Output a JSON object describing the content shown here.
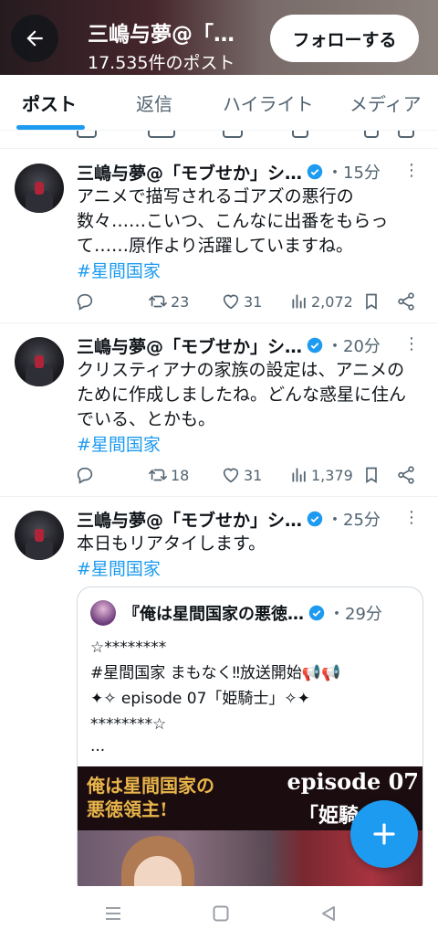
{
  "header": {
    "title": "三嶋与夢@「…",
    "post_count": "17.535件のポスト",
    "follow_label": "フォローする"
  },
  "tabs": [
    {
      "label": "ポスト",
      "active": true
    },
    {
      "label": "返信",
      "active": false
    },
    {
      "label": "ハイライト",
      "active": false
    },
    {
      "label": "メディア",
      "active": false
    }
  ],
  "tweets": [
    {
      "name": "三嶋与夢@「モブせか」シ…",
      "time": "・15分",
      "text_lines": [
        "アニメで描写されるゴアズの悪行の",
        "数々……こいつ、こんなに出番をもらっ",
        "て……原作より活躍していますね。"
      ],
      "hashtag": "#星間国家",
      "reposts": "23",
      "likes": "31",
      "views": "2,072"
    },
    {
      "name": "三嶋与夢@「モブせか」シ…",
      "time": "・20分",
      "text_lines": [
        "クリスティアナの家族の設定は、アニメの",
        "ために作成しましたね。どんな惑星に住ん",
        "でいる、とかも。"
      ],
      "hashtag": "#星間国家",
      "reposts": "18",
      "likes": "31",
      "views": "1,379"
    },
    {
      "name": "三嶋与夢@「モブせか」シ…",
      "time": "・25分",
      "text_lines": [
        "本日もリアタイします。"
      ],
      "hashtag": "#星間国家"
    }
  ],
  "quote": {
    "name": "『俺は星間国家の悪徳…",
    "time": "・29分",
    "lines": [
      "☆********",
      "  #星間国家 まもなく‼放送開始📢📢",
      "✦✧ episode 07「姫騎士」✧✦",
      "********☆",
      "..."
    ],
    "image": {
      "logo_line1": "俺は星間国家の",
      "logo_line2": "悪徳領主!",
      "episode": "episode 07",
      "episode_title": "「姫騎士」"
    }
  },
  "colors": {
    "accent": "#1d9bf0",
    "text_primary": "#0f1419",
    "text_secondary": "#536471"
  },
  "icons": [
    "back-arrow-icon",
    "reply-icon",
    "repost-icon",
    "like-icon",
    "views-icon",
    "bookmark-icon",
    "share-icon",
    "verified-icon",
    "more-icon",
    "compose-plus-icon",
    "nav-menu-icon",
    "nav-home-icon",
    "nav-back-icon"
  ]
}
